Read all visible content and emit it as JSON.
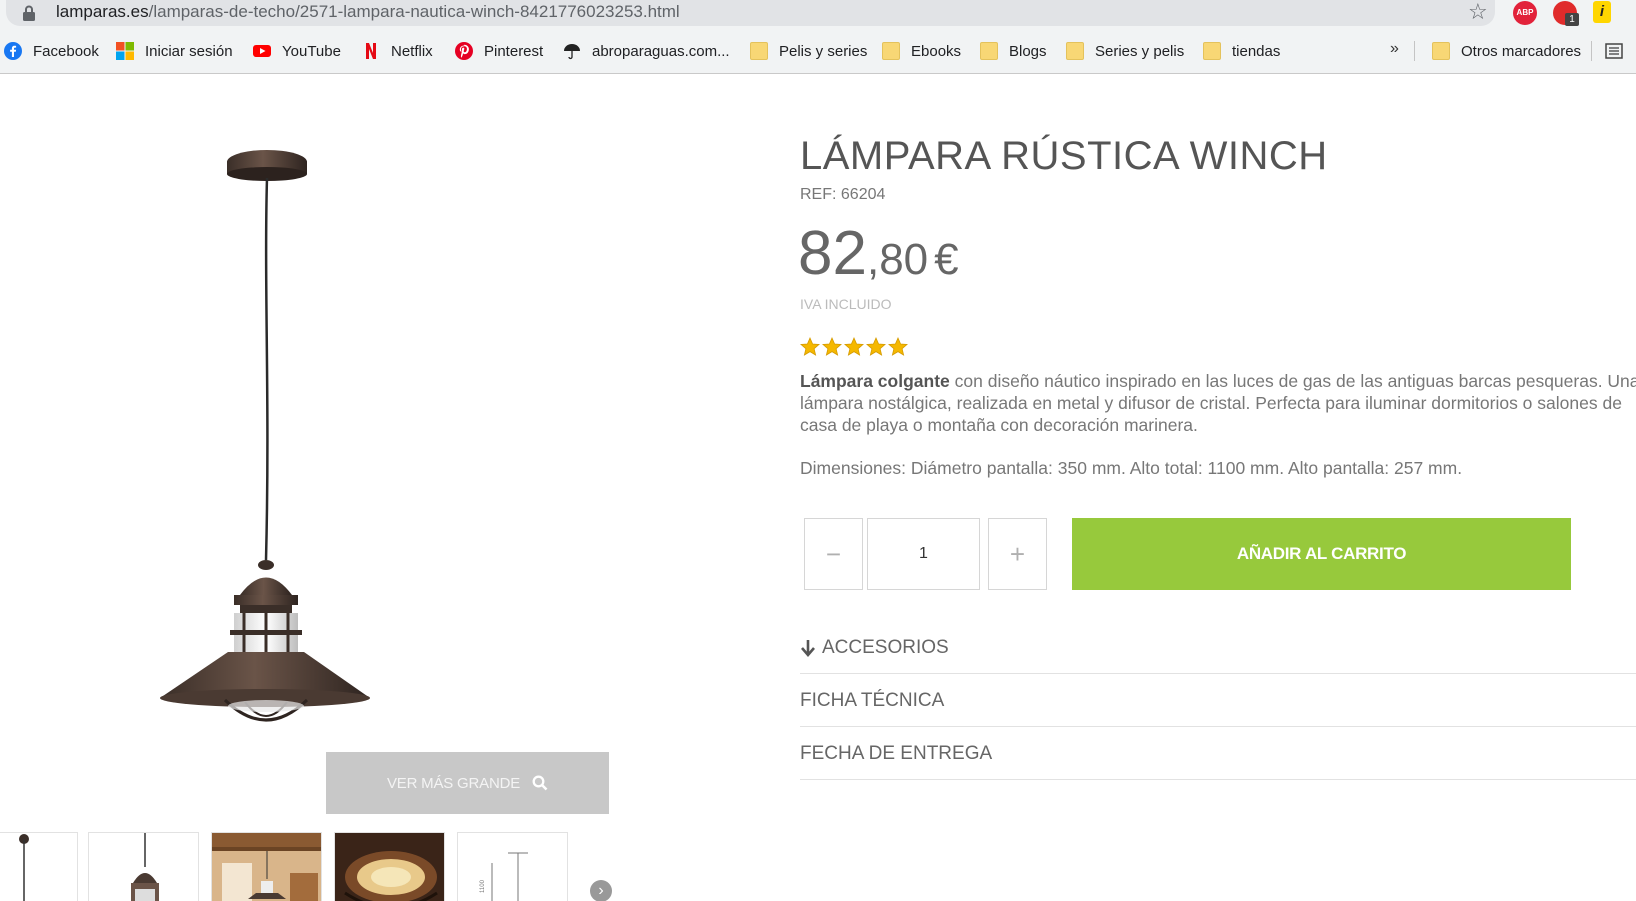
{
  "browser": {
    "url_domain": "lamparas.es",
    "url_path": "/lamparas-de-techo/2571-lampara-nautica-winch-8421776023253.html",
    "extensions": {
      "abp_label": "ABP",
      "badge_count": "1"
    },
    "bookmarks": [
      {
        "label": "Facebook",
        "icon": "facebook-icon"
      },
      {
        "label": "Iniciar sesión",
        "icon": "microsoft-icon"
      },
      {
        "label": "YouTube",
        "icon": "youtube-icon"
      },
      {
        "label": "Netflix",
        "icon": "netflix-icon"
      },
      {
        "label": "Pinterest",
        "icon": "pinterest-icon"
      },
      {
        "label": "abroparaguas.com...",
        "icon": "umbrella-icon"
      },
      {
        "label": "Pelis y series",
        "icon": "folder-icon"
      },
      {
        "label": "Ebooks",
        "icon": "folder-icon"
      },
      {
        "label": "Blogs",
        "icon": "folder-icon"
      },
      {
        "label": "Series y pelis",
        "icon": "folder-icon"
      },
      {
        "label": "tiendas",
        "icon": "folder-icon"
      }
    ],
    "overflow_label": "»",
    "other_bookmarks": "Otros marcadores"
  },
  "gallery": {
    "zoom_button_label": "VER MÁS GRANDE"
  },
  "product": {
    "title": "LÁMPARA RÚSTICA WINCH",
    "ref": "REF: 66204",
    "price_integer": "82",
    "price_decimal": ",80",
    "currency": "€",
    "tax_note": "IVA INCLUIDO",
    "rating": 5,
    "description_bold": "Lámpara colgante",
    "description_rest": " con diseño náutico inspirado en las luces de gas de las antiguas barcas pesqueras. Una lámpara nostálgica, realizada en metal y difusor de cristal. Perfecta para iluminar dormitorios o salones de casa de playa o montaña con decoración marinera.",
    "dimensions": "Dimensiones: Diámetro pantalla: 350 mm. Alto total: 1100 mm. Alto pantalla: 257 mm.",
    "quantity": "1",
    "add_to_cart_label": "AÑADIR AL CARRITO",
    "minus_label": "−",
    "plus_label": "+"
  },
  "sections": [
    {
      "label": "ACCESORIOS"
    },
    {
      "label": "FICHA TÉCNICA"
    },
    {
      "label": "FECHA DE ENTREGA"
    }
  ],
  "colors": {
    "accent_green": "#97c93c",
    "star_gold": "#f5b800",
    "text_gray": "#555555"
  }
}
